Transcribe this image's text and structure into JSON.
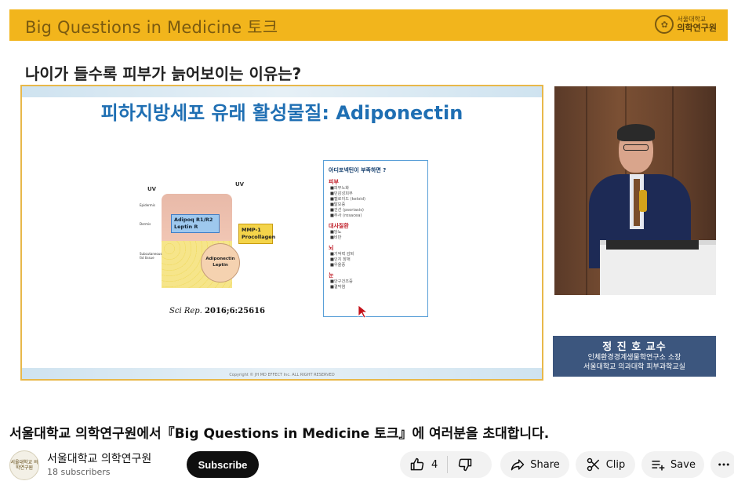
{
  "video": {
    "banner_title": "Big Questions in Medicine 토크",
    "banner_logo_small": "서울대학교",
    "banner_logo_big": "의학연구원",
    "question": "나이가 들수록 피부가 늙어보이는 이유는?",
    "slide": {
      "title": "피하지방세포 유래 활성물질: Adiponectin",
      "diagram": {
        "uv_left": "UV",
        "uv_right": "UV",
        "epidermis": "Epidermis",
        "dermis": "Dermis",
        "subcutaneous": "Subcutaneous fat tissue",
        "adipoq_line1": "Adipoq R1/R2",
        "adipoq_line2": "Leptin R",
        "mmp_line1": "MMP-1",
        "mmp_line2": "Procollagen",
        "circle_line1": "Adiponectin",
        "circle_line2": "Leptin"
      },
      "citation_journal": "Sci Rep.",
      "citation_rest": "2016;6:25616",
      "deficiency_box": {
        "heading": "아디포넥틴이 부족하면 ?",
        "categories": [
          {
            "name": "피부",
            "items": [
              "피부노화",
              "민감성피부",
              "켈로이드 (keloid)",
              "탈모증",
              "건선 (psoriasis)",
              "주사 (rosacea)"
            ]
          },
          {
            "name": "대사질환",
            "items": [
              "당뇨",
              "비만"
            ]
          },
          {
            "name": "뇌",
            "items": [
              "기억력 감퇴",
              "인지 장애",
              "우울증"
            ]
          },
          {
            "name": "눈",
            "items": [
              "안구건조증",
              "결막염"
            ]
          }
        ]
      },
      "copyright": "Copyright © JH MD EFFECT Inc. ALL RIGHT RESERVED"
    },
    "speaker": {
      "name": "정 진 호 교수",
      "role1": "인체환경경계생물학연구소 소장",
      "role2": "서울대학교 의과대학 피부과학교실"
    }
  },
  "meta": {
    "title": "서울대학교 의학연구원에서『Big Questions in Medicine 토크』에 여러분을 초대합니다.",
    "channel_name": "서울대학교 의학연구원",
    "subscribers": "18 subscribers",
    "avatar_text": "서울대학교 의학연구원",
    "subscribe_label": "Subscribe",
    "like_count": "4",
    "share_label": "Share",
    "clip_label": "Clip",
    "save_label": "Save"
  },
  "colors": {
    "banner": "#f2b51c",
    "slide_title": "#1f6fb3",
    "name_box": "#3c567e",
    "subscribe_bg": "#0f0f0f",
    "pill_bg": "#f2f2f2"
  },
  "icons": [
    "like-icon",
    "dislike-icon",
    "share-icon",
    "clip-icon",
    "save-icon",
    "more-icon",
    "cursor-icon"
  ]
}
